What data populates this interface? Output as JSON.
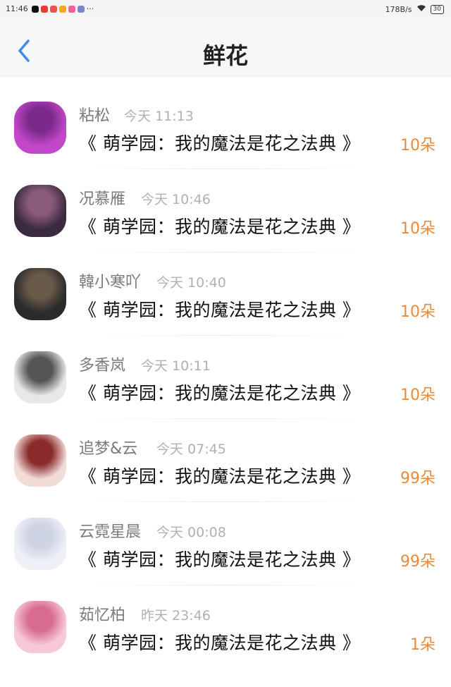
{
  "status_bar": {
    "time": "11:46",
    "network_speed": "178B/s",
    "battery": "30"
  },
  "header": {
    "title": "鲜花"
  },
  "rows": [
    {
      "name": "粘松",
      "time": "今天 11:13",
      "book": "《 萌学园：我的魔法是花之法典 》",
      "count": "10朵",
      "avatar_colors": [
        "#c347c9",
        "#7b2a8c"
      ]
    },
    {
      "name": "况慕雁",
      "time": "今天 10:46",
      "book": "《 萌学园：我的魔法是花之法典 》",
      "count": "10朵",
      "avatar_colors": [
        "#3a2b3f",
        "#8a5a7a"
      ]
    },
    {
      "name": "韓小寒吖",
      "time": "今天 10:40",
      "book": "《 萌学园：我的魔法是花之法典 》",
      "count": "10朵",
      "avatar_colors": [
        "#2b2b2b",
        "#6a5a4a"
      ]
    },
    {
      "name": "多香岚",
      "time": "今天 10:11",
      "book": "《 萌学园：我的魔法是花之法典 》",
      "count": "10朵",
      "avatar_colors": [
        "#e8e8e8",
        "#555555"
      ]
    },
    {
      "name": "追梦&云",
      "time": "今天 07:45",
      "book": "《 萌学园：我的魔法是花之法典 》",
      "count": "99朵",
      "avatar_colors": [
        "#f2dcd8",
        "#8a2a2a"
      ]
    },
    {
      "name": "云霓星晨",
      "time": "今天 00:08",
      "book": "《 萌学园：我的魔法是花之法典 》",
      "count": "99朵",
      "avatar_colors": [
        "#eef0f6",
        "#cfd4e4"
      ]
    },
    {
      "name": "茹忆柏",
      "time": "昨天 23:46",
      "book": "《 萌学园：我的魔法是花之法典 》",
      "count": "1朵",
      "avatar_colors": [
        "#f7c9d6",
        "#d86c8f"
      ]
    }
  ]
}
